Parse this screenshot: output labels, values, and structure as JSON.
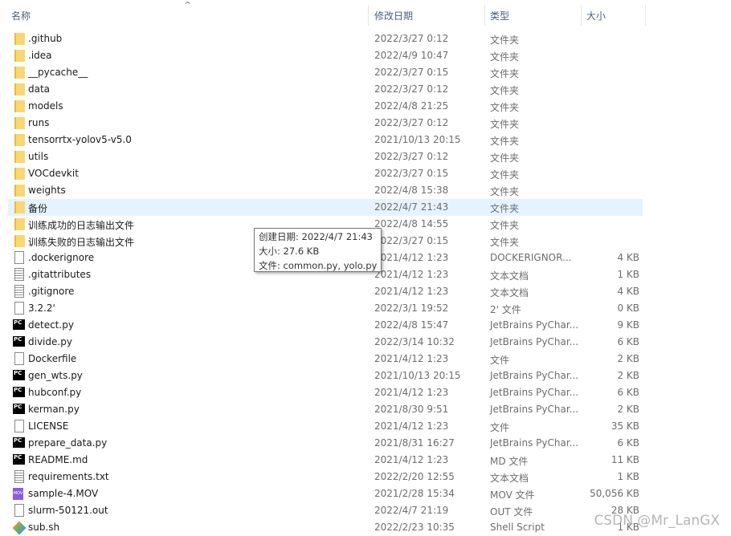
{
  "header": {
    "name": "名称",
    "date": "修改日期",
    "type": "类型",
    "size": "大小"
  },
  "rows": [
    {
      "name": ".github",
      "date": "2022/3/27 0:12",
      "type": "文件夹",
      "size": "",
      "icon": "folder"
    },
    {
      "name": ".idea",
      "date": "2022/4/9 10:47",
      "type": "文件夹",
      "size": "",
      "icon": "folder"
    },
    {
      "name": "__pycache__",
      "date": "2022/3/27 0:15",
      "type": "文件夹",
      "size": "",
      "icon": "folder"
    },
    {
      "name": "data",
      "date": "2022/3/27 0:12",
      "type": "文件夹",
      "size": "",
      "icon": "folder"
    },
    {
      "name": "models",
      "date": "2022/4/8 21:25",
      "type": "文件夹",
      "size": "",
      "icon": "folder"
    },
    {
      "name": "runs",
      "date": "2022/3/27 0:12",
      "type": "文件夹",
      "size": "",
      "icon": "folder"
    },
    {
      "name": "tensorrtx-yolov5-v5.0",
      "date": "2021/10/13 20:15",
      "type": "文件夹",
      "size": "",
      "icon": "folder"
    },
    {
      "name": "utils",
      "date": "2022/3/27 0:12",
      "type": "文件夹",
      "size": "",
      "icon": "folder"
    },
    {
      "name": "VOCdevkit",
      "date": "2022/3/27 0:15",
      "type": "文件夹",
      "size": "",
      "icon": "folder"
    },
    {
      "name": "weights",
      "date": "2022/4/8 15:38",
      "type": "文件夹",
      "size": "",
      "icon": "folder"
    },
    {
      "name": "备份",
      "date": "2022/4/7 21:43",
      "type": "文件夹",
      "size": "",
      "icon": "folder",
      "hover": true
    },
    {
      "name": "训练成功的日志输出文件",
      "date": "2022/4/8 14:55",
      "type": "文件夹",
      "size": "",
      "icon": "folder"
    },
    {
      "name": "训练失败的日志输出文件",
      "date": "2022/3/27 0:15",
      "type": "文件夹",
      "size": "",
      "icon": "folder"
    },
    {
      "name": ".dockerignore",
      "date": "2021/4/12 1:23",
      "type": "DOCKERIGNOR...",
      "size": "4 KB",
      "icon": "file"
    },
    {
      "name": ".gitattributes",
      "date": "2021/4/12 1:23",
      "type": "文本文档",
      "size": "1 KB",
      "icon": "doc"
    },
    {
      "name": ".gitignore",
      "date": "2021/4/12 1:23",
      "type": "文本文档",
      "size": "4 KB",
      "icon": "doc"
    },
    {
      "name": "3.2.2'",
      "date": "2022/3/1 19:52",
      "type": "2' 文件",
      "size": "0 KB",
      "icon": "file"
    },
    {
      "name": "detect.py",
      "date": "2022/4/8 15:47",
      "type": "JetBrains PyChar...",
      "size": "9 KB",
      "icon": "pc"
    },
    {
      "name": "divide.py",
      "date": "2022/3/14 10:32",
      "type": "JetBrains PyChar...",
      "size": "6 KB",
      "icon": "pc"
    },
    {
      "name": "Dockerfile",
      "date": "2021/4/12 1:23",
      "type": "文件",
      "size": "2 KB",
      "icon": "file"
    },
    {
      "name": "gen_wts.py",
      "date": "2021/10/13 20:15",
      "type": "JetBrains PyChar...",
      "size": "2 KB",
      "icon": "pc"
    },
    {
      "name": "hubconf.py",
      "date": "2021/4/12 1:23",
      "type": "JetBrains PyChar...",
      "size": "6 KB",
      "icon": "pc"
    },
    {
      "name": "kerman.py",
      "date": "2021/8/30 9:51",
      "type": "JetBrains PyChar...",
      "size": "2 KB",
      "icon": "pc"
    },
    {
      "name": "LICENSE",
      "date": "2021/4/12 1:23",
      "type": "文件",
      "size": "35 KB",
      "icon": "file"
    },
    {
      "name": "prepare_data.py",
      "date": "2021/8/31 16:27",
      "type": "JetBrains PyChar...",
      "size": "6 KB",
      "icon": "pc"
    },
    {
      "name": "README.md",
      "date": "2021/4/12 1:23",
      "type": "MD 文件",
      "size": "11 KB",
      "icon": "pc"
    },
    {
      "name": "requirements.txt",
      "date": "2022/2/20 12:55",
      "type": "文本文档",
      "size": "1 KB",
      "icon": "doc"
    },
    {
      "name": "sample-4.MOV",
      "date": "2021/2/28 15:34",
      "type": "MOV 文件",
      "size": "50,056 KB",
      "icon": "mov"
    },
    {
      "name": "slurm-50121.out",
      "date": "2022/4/7 21:19",
      "type": "OUT 文件",
      "size": "28 KB",
      "icon": "file"
    },
    {
      "name": "sub.sh",
      "date": "2022/2/23 10:35",
      "type": "Shell Script",
      "size": "1 KB",
      "icon": "sh"
    }
  ],
  "tooltip": {
    "created": "创建日期: 2022/4/7 21:43",
    "size": "大小: 27.6 KB",
    "files": "文件: common.py, yolo.py"
  },
  "watermark": "CSDN @Mr_LanGX",
  "colors": {
    "hover": "#e5f3ff",
    "folder": "#f8d775"
  }
}
